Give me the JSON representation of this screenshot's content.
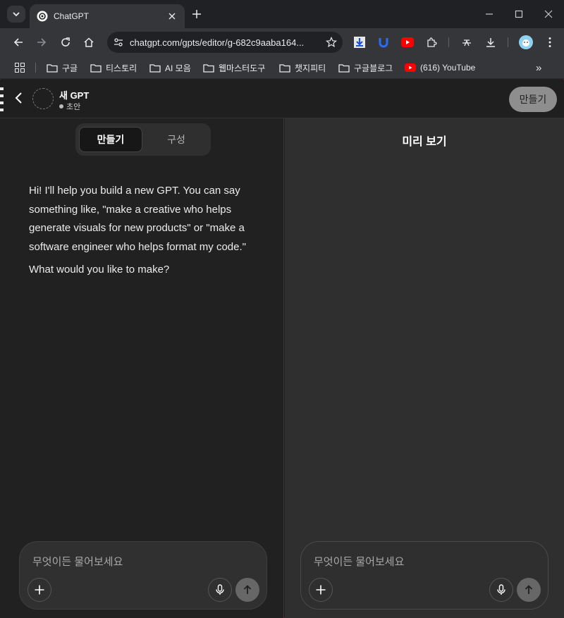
{
  "browser": {
    "tab_title": "ChatGPT",
    "url": "chatgpt.com/gpts/editor/g-682c9aaba164...",
    "bookmarks": [
      {
        "label": "구글",
        "icon": "folder-icon"
      },
      {
        "label": "티스토리",
        "icon": "folder-icon"
      },
      {
        "label": "AI 모음",
        "icon": "folder-icon"
      },
      {
        "label": "웹마스터도구",
        "icon": "folder-icon"
      },
      {
        "label": "챗지피티",
        "icon": "folder-icon"
      },
      {
        "label": "구글블로그",
        "icon": "folder-icon"
      },
      {
        "label": "(616) YouTube",
        "icon": "youtube-icon"
      }
    ],
    "more_bookmarks": "»"
  },
  "editor": {
    "gpt_name": "새 GPT",
    "gpt_status": "초안",
    "create_button": "만들기"
  },
  "left_pane": {
    "tabs": [
      {
        "label": "만들기",
        "active": true
      },
      {
        "label": "구성",
        "active": false
      }
    ],
    "message_paragraphs": [
      "Hi! I'll help you build a new GPT. You can say something like, \"make a creative who helps generate visuals for new products\" or \"make a software engineer who helps format my code.\"",
      "What would you like to make?"
    ],
    "composer_placeholder": "무엇이든 물어보세요"
  },
  "right_pane": {
    "title": "미리 보기",
    "composer_placeholder": "무엇이든 물어보세요"
  }
}
